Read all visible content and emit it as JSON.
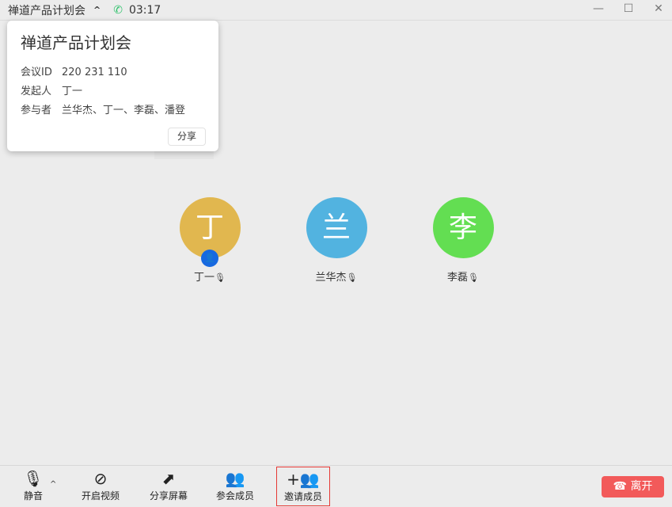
{
  "titlebar": {
    "title": "禅道产品计划会",
    "caret": "^",
    "phone_icon": "phone-icon",
    "time": "03:17",
    "minimize": "—",
    "maximize": "☐",
    "close": "✕"
  },
  "popup": {
    "title": "禅道产品计划会",
    "rows": [
      {
        "label": "会议ID",
        "value": "220 231 110"
      },
      {
        "label": "发起人",
        "value": "丁一"
      },
      {
        "label": "参与者",
        "value": "兰华杰、丁一、李磊、潘登"
      }
    ],
    "share": "分享"
  },
  "participants": [
    {
      "initial": "丁",
      "name": "丁一",
      "color": "#e1b74f",
      "host": true
    },
    {
      "initial": "兰",
      "name": "兰华杰",
      "color": "#52b3e0"
    },
    {
      "initial": "李",
      "name": "李磊",
      "color": "#63de52"
    }
  ],
  "toolbar": {
    "mute": "静音",
    "mute_caret": "^",
    "video": "开启视频",
    "share_screen": "分享屏幕",
    "members": "参会成员",
    "invite": "邀请成员",
    "leave": "离开"
  }
}
